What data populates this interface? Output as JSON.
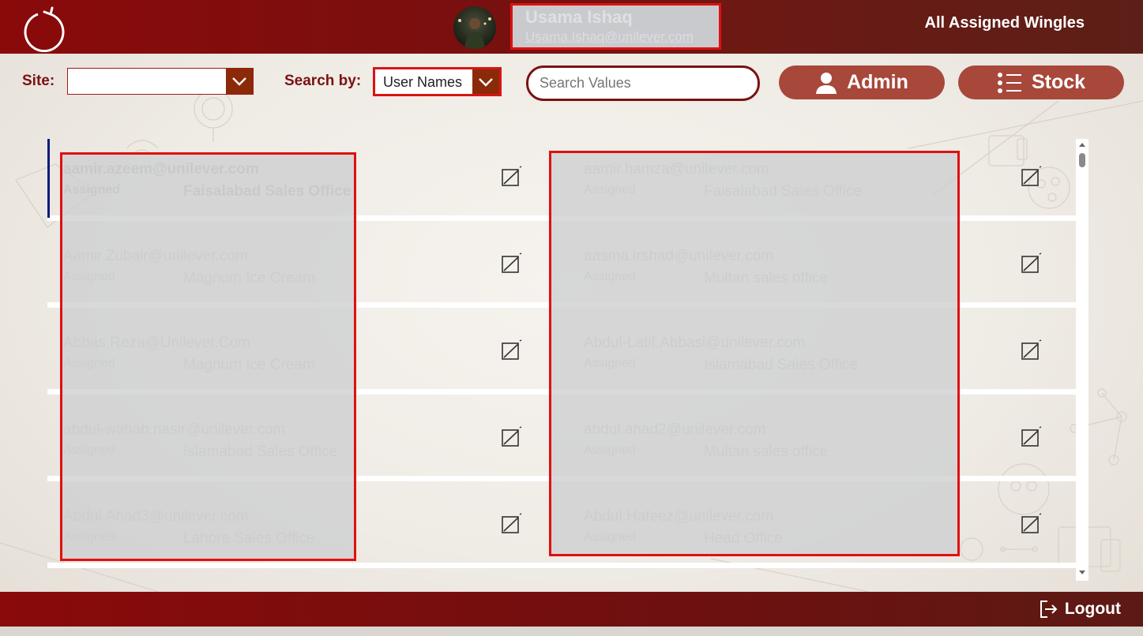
{
  "header": {
    "title": "All Assigned Wingles",
    "user_name": "Usama Ishaq",
    "user_email": "Usama.Ishaq@unilever.com"
  },
  "toolbar": {
    "site_label": "Site:",
    "site_value": "",
    "search_by_label": "Search by:",
    "search_by_value": "User Names",
    "search_placeholder": "Search Values",
    "admin_label": "Admin",
    "stock_label": "Stock"
  },
  "rows": [
    {
      "left": {
        "email": "aamir.azeem@unilever.com",
        "status": "Assigned",
        "office": "Faisalabad Sales Office"
      },
      "right": {
        "email": "aamir.hamza@unilever.com",
        "status": "Assigned",
        "office": "Faisalabad Sales Office"
      }
    },
    {
      "left": {
        "email": "Aamir.Zubair@unilever.com",
        "status": "Assigned",
        "office": "Magnum Ice Cream"
      },
      "right": {
        "email": "aasma.irshad@unilever.com",
        "status": "Assigned",
        "office": "Multan sales office"
      }
    },
    {
      "left": {
        "email": "Abbas.Reza@Unilever.Com",
        "status": "Assigned",
        "office": "Magnum Ice Cream"
      },
      "right": {
        "email": "Abdul-Latif.Abbasi@unilever.com",
        "status": "Assigned",
        "office": "Islamabad Sales Office"
      }
    },
    {
      "left": {
        "email": "abdul-wahab.nasir@unilever.com",
        "status": "Assigned",
        "office": "Islamabad Sales Office"
      },
      "right": {
        "email": "abdul.ahad2@unilever.com",
        "status": "Assigned",
        "office": "Multan sales office"
      }
    },
    {
      "left": {
        "email": "Abdul.Ahad3@unilever.com",
        "status": "Assigned",
        "office": "Lahore Sales Office"
      },
      "right": {
        "email": "Abdul.Hafeez@unilever.com",
        "status": "Assigned",
        "office": "Head Office"
      }
    }
  ],
  "footer": {
    "logout_label": "Logout"
  },
  "colors": {
    "brand": "#8a0a0a",
    "accent_button": "#a8483a",
    "redaction_border": "#e01010"
  }
}
